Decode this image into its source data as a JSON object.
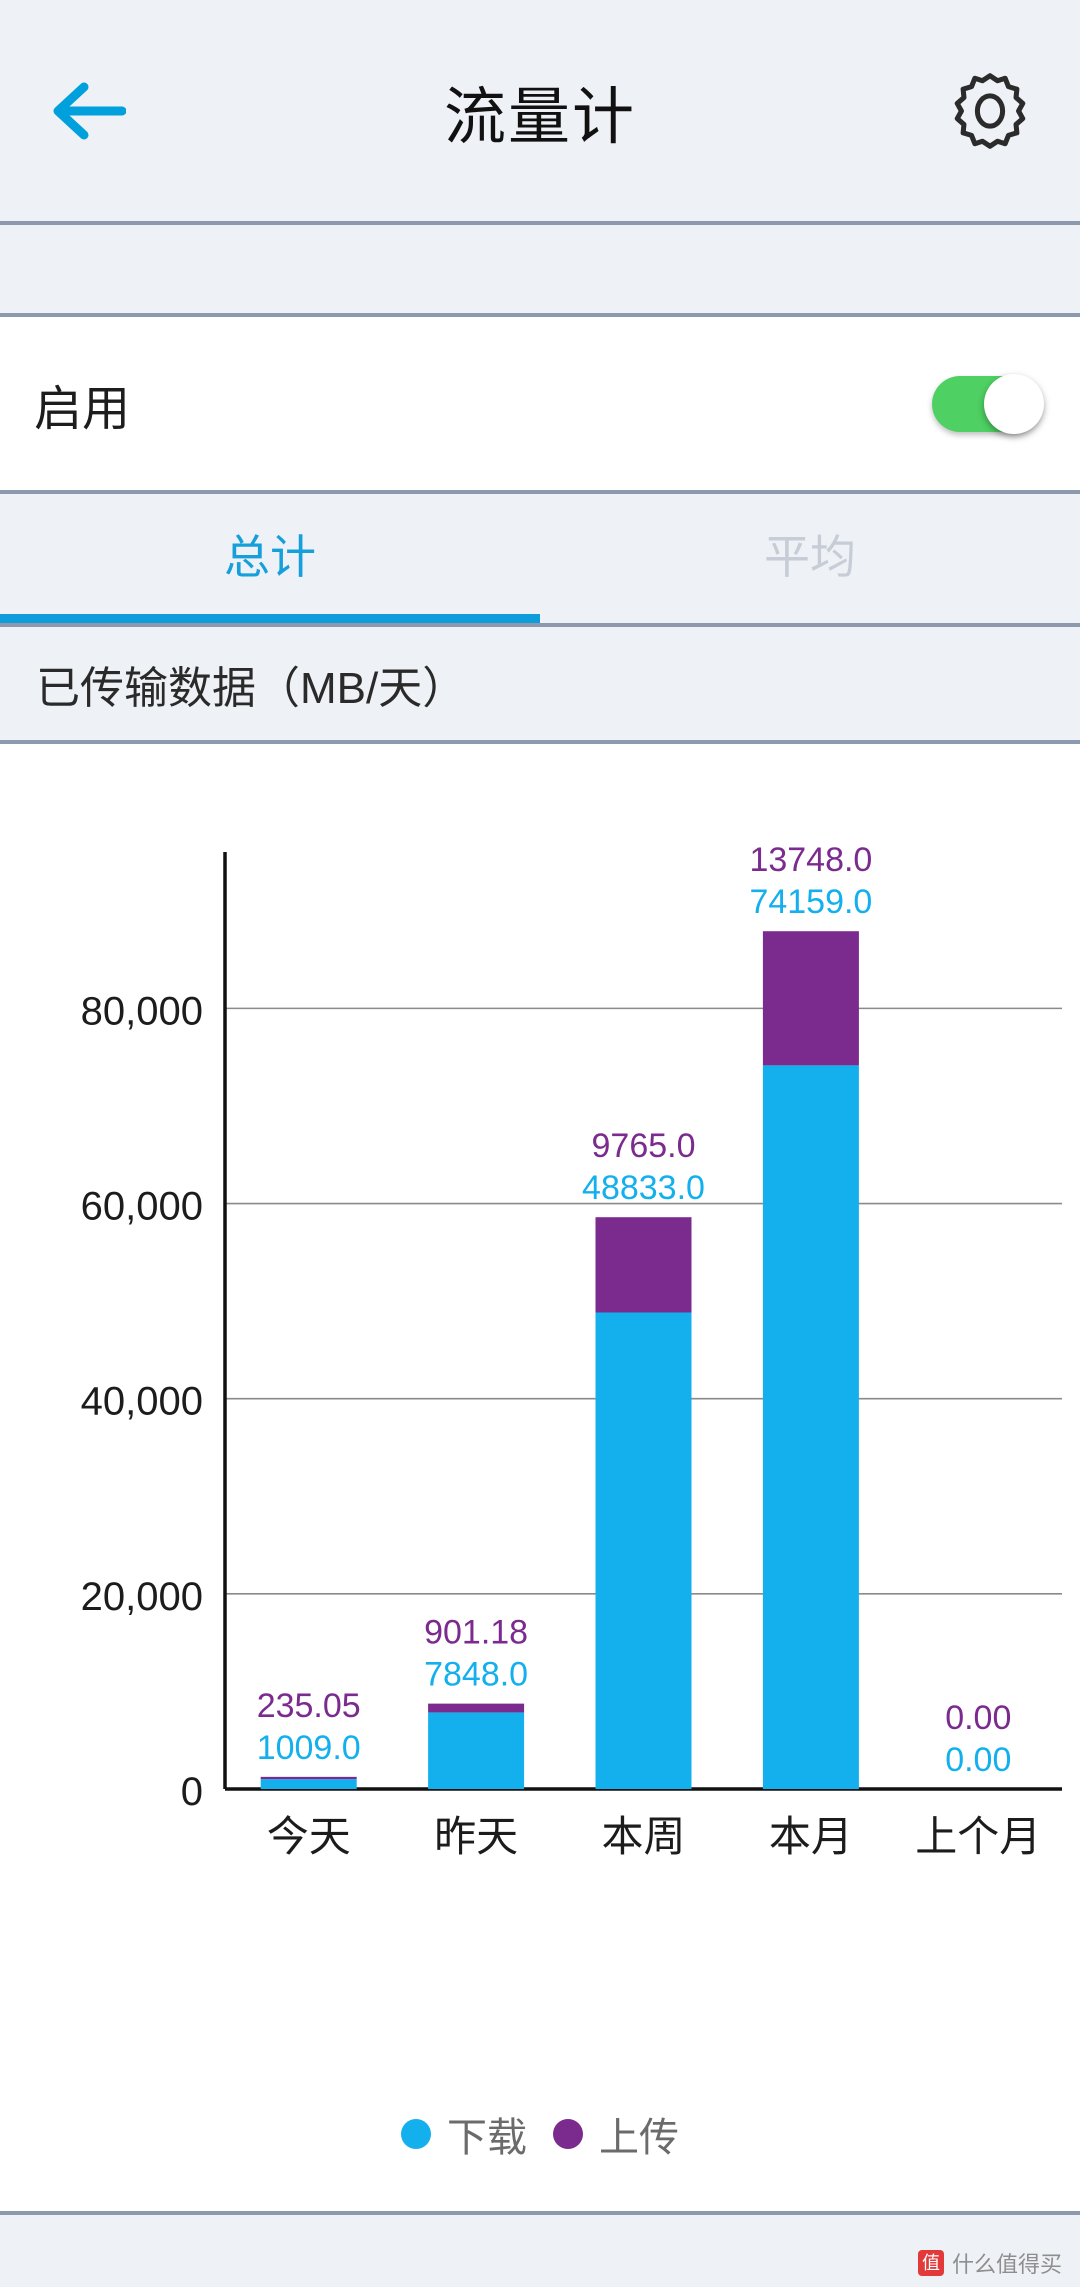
{
  "header": {
    "title": "流量计",
    "back_icon": "arrow-left-icon",
    "settings_icon": "gear-icon",
    "accent_color": "#00a0dd"
  },
  "settings": {
    "enable_label": "启用",
    "enable_state": "on",
    "toggle_color": "#4ed062"
  },
  "tabs": [
    {
      "label": "总计",
      "active": true
    },
    {
      "label": "平均",
      "active": false
    }
  ],
  "section": {
    "title": "已传输数据（MB/天）"
  },
  "legend": [
    {
      "label": "下载",
      "color": "#14b0ed"
    },
    {
      "label": "上传",
      "color": "#7b2a8e"
    }
  ],
  "watermark": {
    "badge": "值",
    "text": "什么值得买"
  },
  "chart_data": {
    "type": "bar",
    "subtype": "stacked",
    "title": "已传输数据（MB/天）",
    "xlabel": "",
    "ylabel": "",
    "ylim": [
      0,
      95000
    ],
    "yticks": [
      0,
      20000,
      40000,
      60000,
      80000
    ],
    "ytick_labels": [
      "0",
      "20,000",
      "40,000",
      "60,000",
      "80,000"
    ],
    "grid": true,
    "legend_position": "bottom",
    "categories": [
      "今天",
      "昨天",
      "本周",
      "本月",
      "上个月"
    ],
    "series": [
      {
        "name": "下载",
        "color": "#14b0ed",
        "values": [
          1009.0,
          7848.0,
          48833.0,
          74159.0,
          0.0
        ],
        "labels": [
          "1009.0",
          "7848.0",
          "48833.0",
          "74159.0",
          "0.00"
        ]
      },
      {
        "name": "上传",
        "color": "#7b2a8e",
        "values": [
          235.05,
          901.18,
          9765.0,
          13748.0,
          0.0
        ],
        "labels": [
          "235.05",
          "901.18",
          "9765.0",
          "13748.0",
          "0.00"
        ]
      }
    ]
  }
}
